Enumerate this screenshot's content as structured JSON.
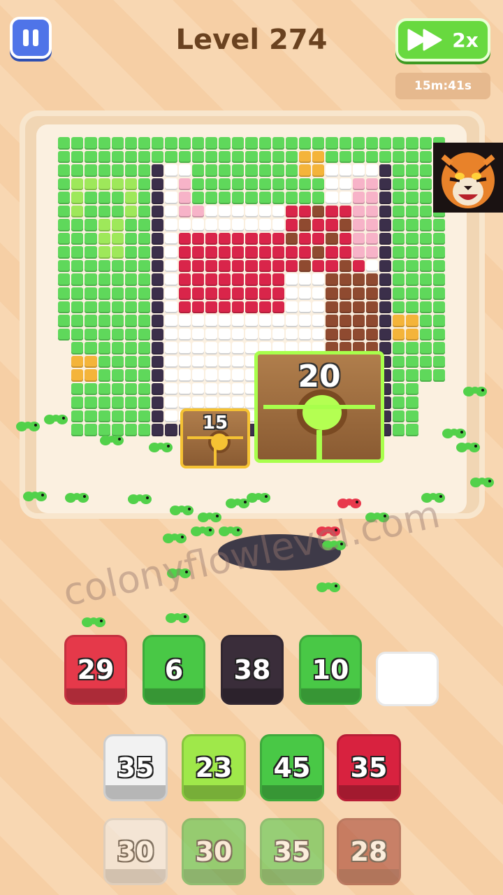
{
  "header": {
    "level_label": "Level 274",
    "speed_label": "2x",
    "timer": "15m:41s"
  },
  "board": {
    "crate_big_count": "20",
    "crate_small_count": "15"
  },
  "watermark": "colonyflowlevel.com",
  "slots": [
    {
      "value": "29",
      "color": "#e5394a"
    },
    {
      "value": "6",
      "color": "#49c846"
    },
    {
      "value": "38",
      "color": "#3a2d3a"
    },
    {
      "value": "10",
      "color": "#49c846"
    },
    {
      "value": "",
      "color": "#ffffff"
    }
  ],
  "queue_row1": [
    {
      "value": "35",
      "color": "#f2f2f2"
    },
    {
      "value": "23",
      "color": "#9fe84a"
    },
    {
      "value": "45",
      "color": "#49c846"
    },
    {
      "value": "35",
      "color": "#d8223f"
    }
  ],
  "queue_row2": [
    {
      "value": "30",
      "color": "#f2f2f2"
    },
    {
      "value": "30",
      "color": "#49c846"
    },
    {
      "value": "35",
      "color": "#49c846"
    },
    {
      "value": "28",
      "color": "#a23a2a"
    }
  ]
}
